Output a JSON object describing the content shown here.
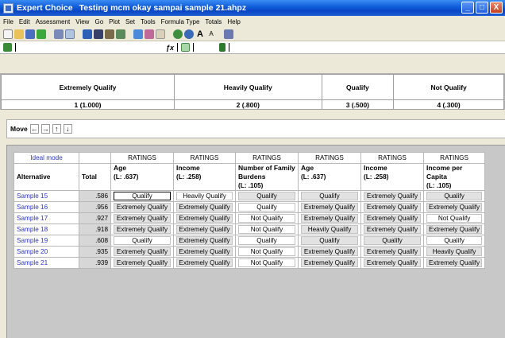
{
  "window": {
    "app_name": "Expert Choice",
    "document": "Testing mcm okay sampai sample 21.ahpz",
    "buttons": [
      "_",
      "□",
      "X"
    ]
  },
  "menu": [
    "File",
    "Edit",
    "Assessment",
    "View",
    "Go",
    "Plot",
    "Set",
    "Tools",
    "Formula Type",
    "Totals",
    "Help"
  ],
  "intensities": [
    {
      "name": "Extremely Qualify",
      "value": "1 (1.000)"
    },
    {
      "name": "Heavily Qualify",
      "value": "2 (.800)"
    },
    {
      "name": "Qualify",
      "value": "3 (.500)"
    },
    {
      "name": "Not Qualify",
      "value": "4 (.300)"
    }
  ],
  "move": {
    "label": "Move",
    "arrows": [
      "←",
      "→",
      "↑",
      "↓"
    ]
  },
  "grid": {
    "mode_label": "Ideal mode",
    "ratings_label": "RATINGS",
    "alt_header": "Alternative",
    "total_header": "Total",
    "criteria": [
      {
        "name": "Age",
        "local": "(L: .637)"
      },
      {
        "name": "Income",
        "local": "(L: .258)"
      },
      {
        "name": "Number of Family Burdens",
        "local": "(L: .105)"
      },
      {
        "name": "Age",
        "local": "(L: .637)"
      },
      {
        "name": "Income",
        "local": "(L: .258)"
      },
      {
        "name": "Income per Capita",
        "local": "(L: .105)"
      }
    ],
    "rows": [
      {
        "name": "Sample 15",
        "total": ".586",
        "ratings": [
          "Qualify",
          "Heavily Qualify",
          "Qualify",
          "Qualify",
          "Extremely Qualify",
          "Qualify"
        ]
      },
      {
        "name": "Sample 16",
        "total": ".956",
        "ratings": [
          "Extremely Qualify",
          "Extremely Qualify",
          "Qualify",
          "Extremely Qualify",
          "Extremely Qualify",
          "Extremely Qualify"
        ]
      },
      {
        "name": "Sample 17",
        "total": ".927",
        "ratings": [
          "Extremely Qualify",
          "Extremely Qualify",
          "Not Qualify",
          "Extremely Qualify",
          "Extremely Qualify",
          "Not Qualify"
        ]
      },
      {
        "name": "Sample 18",
        "total": ".918",
        "ratings": [
          "Extremely Qualify",
          "Extremely Qualify",
          "Not Qualify",
          "Heavily Qualify",
          "Extremely Qualify",
          "Extremely Qualify"
        ]
      },
      {
        "name": "Sample 19",
        "total": ".608",
        "ratings": [
          "Qualify",
          "Extremely Qualify",
          "Qualify",
          "Qualify",
          "Qualify",
          "Qualify"
        ]
      },
      {
        "name": "Sample 20",
        "total": ".935",
        "ratings": [
          "Extremely Qualify",
          "Extremely Qualify",
          "Not Qualify",
          "Extremely Qualify",
          "Extremely Qualify",
          "Heavily Qualify"
        ]
      },
      {
        "name": "Sample 21",
        "total": ".939",
        "ratings": [
          "Extremely Qualify",
          "Extremely Qualify",
          "Not Qualify",
          "Extremely Qualify",
          "Extremely Qualify",
          "Extremely Qualify"
        ]
      }
    ]
  }
}
